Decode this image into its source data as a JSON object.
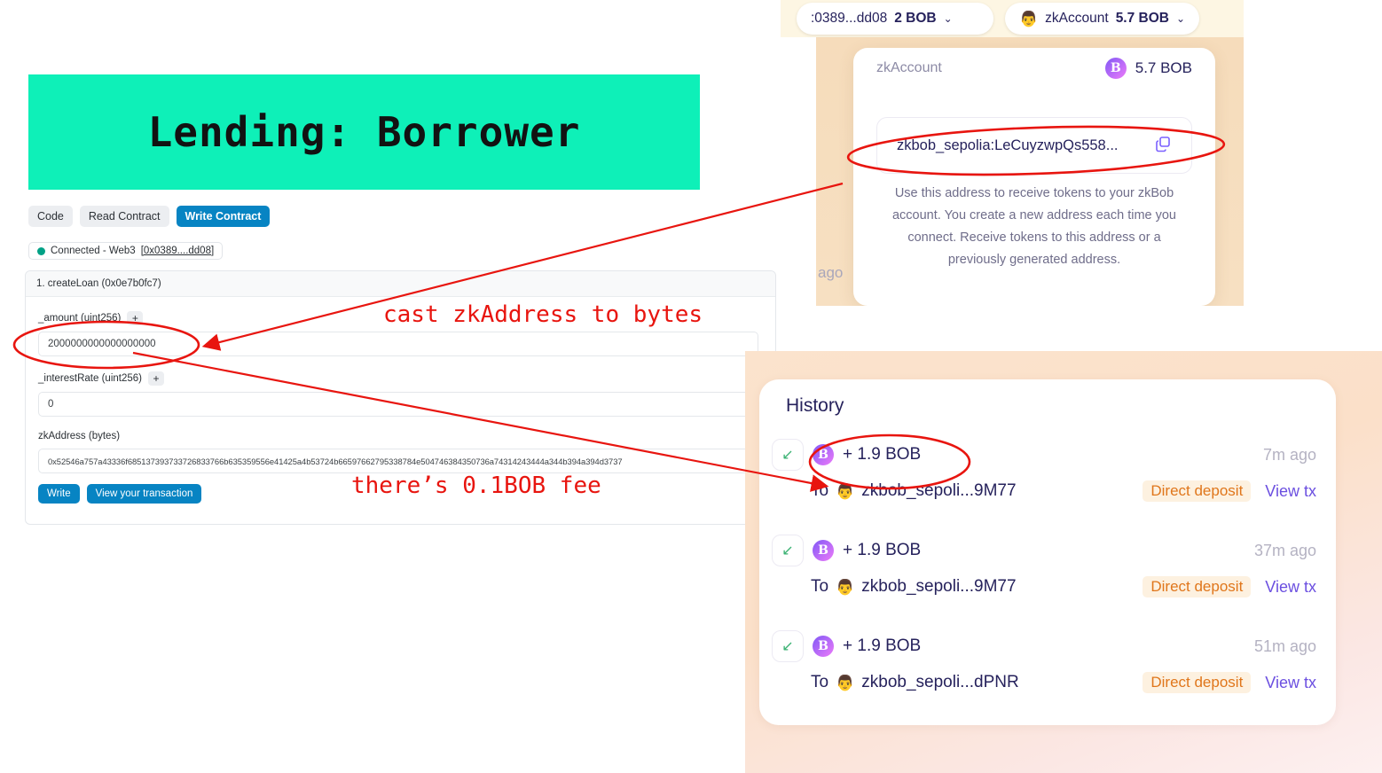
{
  "explorer": {
    "banner_title": "Lending: Borrower",
    "banner_color": "#0ef0b8",
    "tabs": [
      {
        "label": "Code",
        "active": false
      },
      {
        "label": "Read Contract",
        "active": false
      },
      {
        "label": "Write Contract",
        "active": true
      }
    ],
    "connection": {
      "status_text": "Connected - Web3",
      "address": "[0x0389....dd08]",
      "dot_color": "#00a186"
    },
    "function": {
      "header": "1. createLoan (0x0e7b0fc7)",
      "fields": [
        {
          "label": "_amount (uint256)",
          "has_plus": true,
          "plus": "+",
          "value": "2000000000000000000"
        },
        {
          "label": "_interestRate (uint256)",
          "has_plus": true,
          "plus": "+",
          "value": "0"
        },
        {
          "label": "zkAddress (bytes)",
          "has_plus": false,
          "plus": "",
          "value": "0x52546a757a43336f685137393733726833766b635359556e41425a4b53724b66597662795338784e504746384350736a74314243444a344b394a394d3737"
        }
      ],
      "write_button": "Write",
      "view_tx_button": "View your transaction"
    }
  },
  "zkbob": {
    "header_pills": [
      {
        "address": ":0389...dd08",
        "balance": "2 BOB",
        "chevron": "⌄",
        "avatar": ""
      },
      {
        "address": "zkAccount",
        "balance": "5.7 BOB",
        "chevron": "⌄",
        "avatar": "👨"
      }
    ],
    "panel": {
      "label": "zkAccount",
      "balance": "5.7 BOB",
      "coin_glyph": "B",
      "address": "zkbob_sepolia:LeCuyzwpQs558...",
      "copy_icon": "copy-icon",
      "help_text": "Use this address to receive tokens to your zkBob account. You create a new address each time you connect. Receive tokens to this address or a previously generated address.",
      "ghost_text": "ago"
    }
  },
  "history": {
    "title": "History",
    "transactions": [
      {
        "direction_icon": "↙",
        "coin_glyph": "B",
        "amount": "+ 1.9 BOB",
        "when": "7m ago",
        "to_prefix": "To",
        "to_avatar": "👨",
        "to_address": "zkbob_sepoli...9M77",
        "tag": "Direct deposit",
        "link": "View tx"
      },
      {
        "direction_icon": "↙",
        "coin_glyph": "B",
        "amount": "+ 1.9 BOB",
        "when": "37m ago",
        "to_prefix": "To",
        "to_avatar": "👨",
        "to_address": "zkbob_sepoli...9M77",
        "tag": "Direct deposit",
        "link": "View tx"
      },
      {
        "direction_icon": "↙",
        "coin_glyph": "B",
        "amount": "+ 1.9 BOB",
        "when": "51m ago",
        "to_prefix": "To",
        "to_avatar": "👨",
        "to_address": "zkbob_sepoli...dPNR",
        "tag": "Direct deposit",
        "link": "View tx"
      }
    ]
  },
  "annotations": {
    "color": "#e8150f",
    "notes": [
      {
        "text": "cast zkAddress to bytes"
      },
      {
        "text": "there’s 0.1BOB fee"
      }
    ]
  }
}
